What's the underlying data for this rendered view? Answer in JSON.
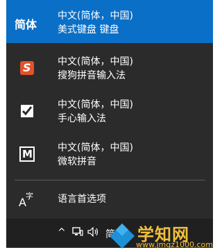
{
  "ime_list": [
    {
      "icon": "jianti-text-icon",
      "icon_text": "简体",
      "line1": "中文(简体，中国)",
      "line2": "美式键盘 键盘",
      "selected": true
    },
    {
      "icon": "sogou-icon",
      "icon_text": "S",
      "line1": "中文(简体，中国)",
      "line2": "搜狗拼音输入法",
      "selected": false
    },
    {
      "icon": "shouxin-icon",
      "icon_text": "",
      "line1": "中文(简体，中国)",
      "line2": "手心输入法",
      "selected": false
    },
    {
      "icon": "microsoft-pinyin-icon",
      "icon_text": "M",
      "line1": "中文(简体，中国)",
      "line2": "微软拼音",
      "selected": false
    }
  ],
  "language_preferences": {
    "label": "语言首选项",
    "icon": "language-icon",
    "icon_text_a": "A",
    "icon_text_zi": "字"
  },
  "taskbar": {
    "chevron": "^",
    "ime_indicator": "简体"
  },
  "watermark": {
    "main": "学知网",
    "sub": "www.jmqz1000.com"
  },
  "colors": {
    "flyout_bg": "#2b2b2b",
    "selected_bg": "#0a6fc7",
    "taskbar_bg": "#202020",
    "sogou_orange": "#e3522a",
    "watermark": "#f2c03a"
  }
}
